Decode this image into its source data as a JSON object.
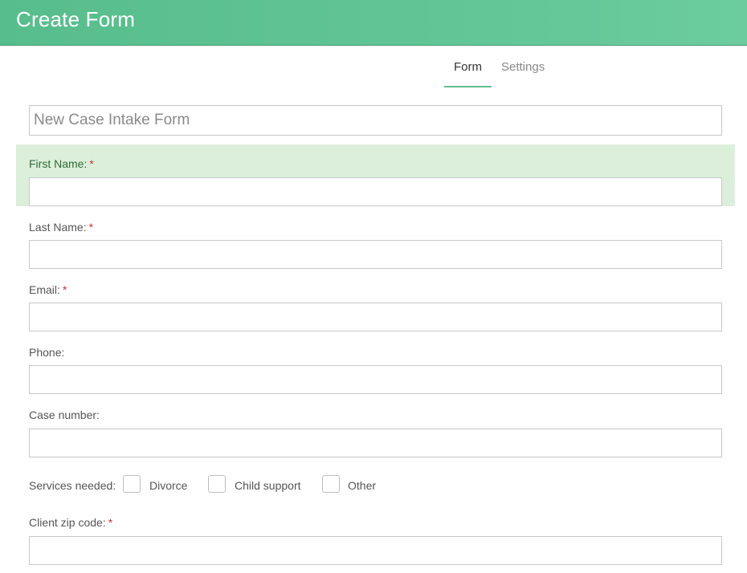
{
  "header": {
    "title": "Create Form"
  },
  "tabs": [
    {
      "label": "Form",
      "active": true
    },
    {
      "label": "Settings",
      "active": false
    }
  ],
  "form_title": {
    "value": "",
    "placeholder": "New Case Intake Form"
  },
  "fields": {
    "first_name": {
      "label": "First Name:",
      "required_mark": "*",
      "value": ""
    },
    "last_name": {
      "label": "Last Name:",
      "required_mark": "*",
      "value": ""
    },
    "email": {
      "label": "Email:",
      "required_mark": "*",
      "value": ""
    },
    "phone": {
      "label": "Phone:",
      "value": ""
    },
    "case_number": {
      "label": "Case number:",
      "value": ""
    },
    "zip_code": {
      "label": "Client zip code:",
      "required_mark": "*",
      "value": ""
    }
  },
  "services": {
    "label": "Services needed:",
    "options": [
      {
        "label": "Divorce",
        "checked": false
      },
      {
        "label": "Child support",
        "checked": false
      },
      {
        "label": "Other",
        "checked": false
      }
    ]
  },
  "colors": {
    "header": "#5ec293",
    "tab_underline": "#62bf92",
    "highlight": "#dcefda",
    "required": "#cc3333"
  }
}
